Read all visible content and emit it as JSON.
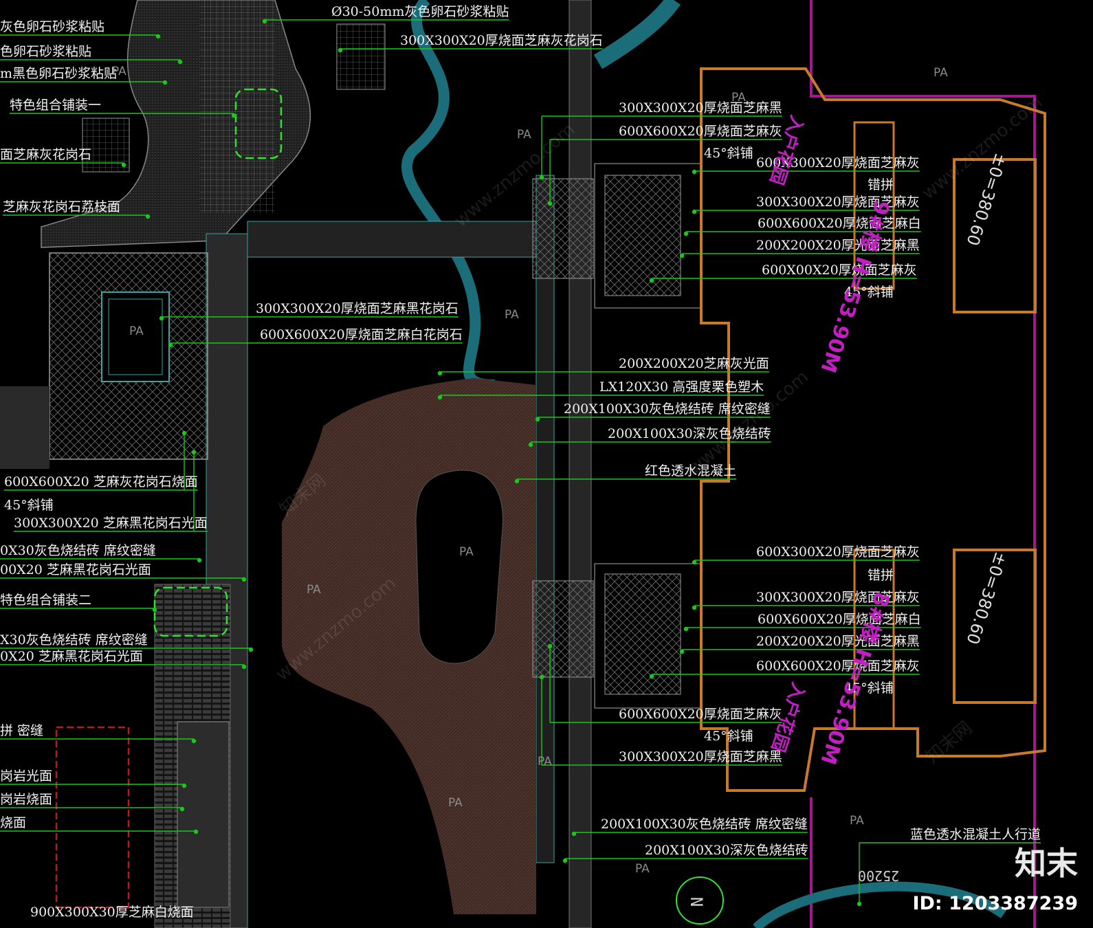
{
  "colors": {
    "background": "#000000",
    "leader": "#19c919",
    "building_outline": "#c87a2a",
    "property_line": "#a3178f",
    "stream": "#1c6d7a",
    "road": "#2f2f2f",
    "plaza_red": "#3f2a24",
    "text": "#f2f2f2",
    "pa_text": "#8a8a8a",
    "vertical_label": "#c21fc2"
  },
  "callouts_left": [
    "灰色卵石砂浆粘贴",
    "色卵石砂浆粘贴",
    "m黑色卵石砂浆粘贴",
    "特色组合铺装一",
    "面芝麻灰花岗石",
    "芝麻灰花岗石荔枝面",
    "600X600X20 芝麻灰花岗石烧面",
    "45°斜铺",
    "300X300X20 芝麻黑花岗石光面",
    "0X30灰色烧结砖 席纹密缝",
    "00X20 芝麻黑花岗石光面",
    "特色组合铺装二",
    "X30灰色烧结砖 席纹密缝",
    "0X20 芝麻黑花岗石光面",
    "拼 密缝",
    "岗岩光面",
    "岗岩烧面",
    "烧面",
    "900X300X30厚芝麻白烧面"
  ],
  "callouts_top": [
    "Ø30-50mm灰色卵石砂浆粘贴",
    "300X300X20厚烧面芝麻灰花岗石"
  ],
  "callouts_mid": [
    "300X300X20厚烧面芝麻黑花岗石",
    "600X600X20厚烧面芝麻白花岗石",
    "200X200X20芝麻灰光面",
    "LX120X30 高强度栗色塑木",
    "200X100X30灰色烧结砖 席纹密缝",
    "200X100X30深灰色烧结砖",
    "红色透水混凝土"
  ],
  "callouts_upper_bldg": [
    "300X300X20厚烧面芝麻黑",
    "600X600X20厚烧面芝麻灰",
    "45°斜铺",
    "600X300X20厚烧面芝麻灰",
    "错拼",
    "300X300X20厚烧面芝麻灰",
    "600X600X20厚烧面芝麻白",
    "200X200X20厚光面芝麻黑",
    "600X00X20厚烧面芝麻灰",
    "45°斜铺"
  ],
  "callouts_lower_bldg": [
    "600X300X20厚烧面芝麻灰",
    "错拼",
    "300X300X20厚烧面芝麻灰",
    "600X600X20厚烧面芝麻白",
    "200X200X20厚光面芝麻黑",
    "600X600X20厚烧面芝麻灰",
    "45°斜铺",
    "600X600X20厚烧面芝麻灰",
    "45°斜铺",
    "300X300X20厚烧面芝麻黑"
  ],
  "callouts_bottom": [
    "200X100X30灰色烧结砖 席纹密缝",
    "200X100X30深灰色烧结砖",
    "蓝色透水混凝土人行道"
  ],
  "pa_label": "PA",
  "building_labels": [
    "9#楼 H=53.90M",
    "±0=380.60",
    "8#楼 H=53.90M",
    "±0=380.60",
    "入户花园",
    "入户花园"
  ],
  "dimension": "25200",
  "north_mark": "N",
  "brand_mark": "知末",
  "image_id": "ID: 1203387239",
  "watermark": "www.znzmo.com",
  "watermark_cn": "知末网"
}
